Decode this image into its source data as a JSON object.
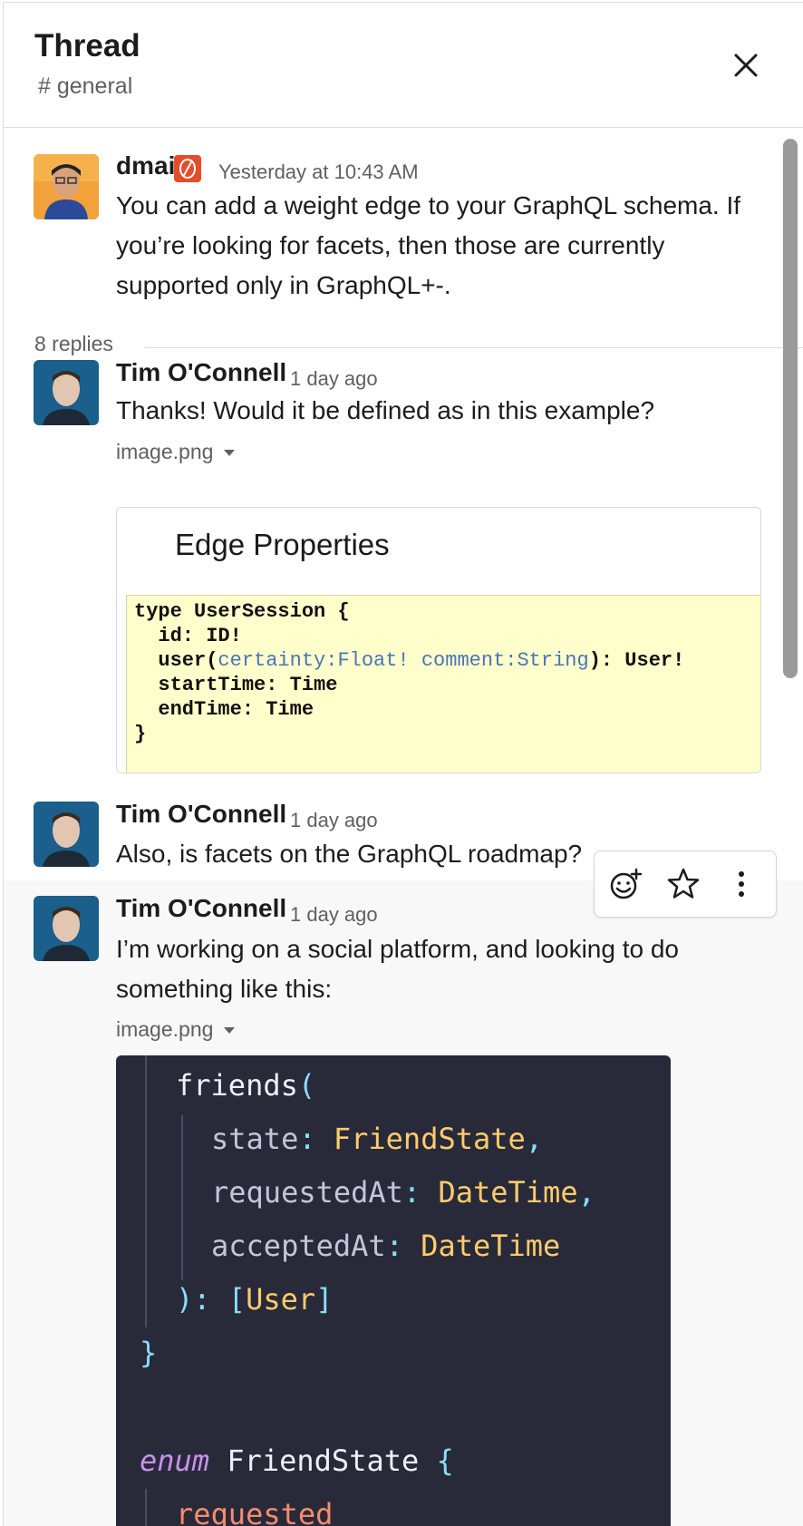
{
  "header": {
    "title": "Thread",
    "channel": "# general"
  },
  "root_message": {
    "author": "dmai",
    "timestamp": "Yesterday at 10:43 AM",
    "text": "You can add a weight edge to your GraphQL schema. If you’re looking for facets, then those are currently supported only in GraphQL+-."
  },
  "replies_count": "8 replies",
  "messages": [
    {
      "author": "Tim O'Connell",
      "timestamp": "1 day ago",
      "text": "Thanks! Would it be defined as in this example?",
      "attachment_name": "image.png",
      "image_title": "Edge Properties"
    },
    {
      "author": "Tim O'Connell",
      "timestamp": "1 day ago",
      "text": "Also, is facets on the GraphQL roadmap?"
    },
    {
      "author": "Tim O'Connell",
      "timestamp": "1 day ago",
      "text": "I’m working on a social platform, and looking to do something like this:",
      "attachment_name": "image.png"
    }
  ],
  "colors": {
    "accent_badge": "#e44d2a",
    "code_bg_light": "#ffffcc",
    "code_bg_dark": "#282a3a"
  },
  "icons": {
    "close": "close-icon",
    "add_reaction": "add-reaction-icon",
    "save": "star-icon",
    "more": "more-vertical-icon",
    "badge": "status-badge-icon"
  }
}
